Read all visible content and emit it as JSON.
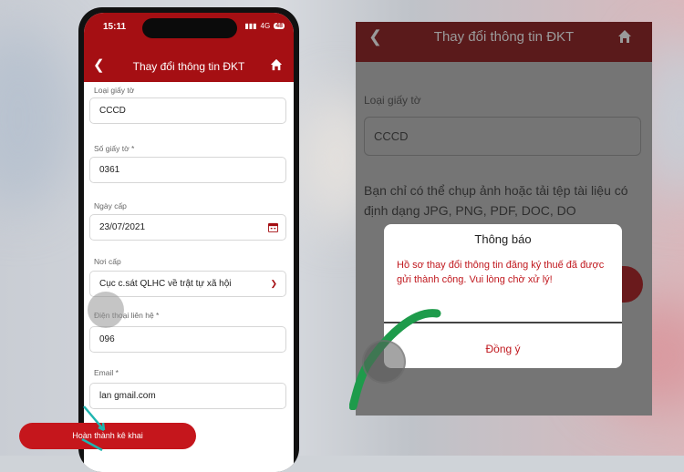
{
  "status": {
    "time": "15:11",
    "network": "4G",
    "battery": "48"
  },
  "header": {
    "title": "Thay đổi thông tin ĐKT"
  },
  "form": {
    "fields": [
      {
        "label": "Loại giấy tờ",
        "value": "CCCD"
      },
      {
        "label": "Số giấy tờ *",
        "value": "0361"
      },
      {
        "label": "Ngày cấp",
        "value": "23/07/2021"
      },
      {
        "label": "Nơi cấp",
        "value": "Cục c.sát QLHC về trật tự xã hội"
      },
      {
        "label": "Điện thoại liên hệ *",
        "value": "096"
      },
      {
        "label": "Email *",
        "value": "lan                    gmail.com"
      }
    ],
    "submit_label": "Hoàn thành kê khai"
  },
  "zoom": {
    "title": "Thay đổi thông tin ĐKT",
    "label": "Loại giấy tờ",
    "value": "CCCD",
    "info": "Bạn chỉ có thể chụp ảnh hoặc tải tệp tài liệu có định dạng JPG, PNG, PDF, DOC, DO"
  },
  "dialog": {
    "title": "Thông báo",
    "message": "Hồ sơ thay đổi thông tin đăng ký thuế đã được gửi thành công. Vui lòng chờ xử lý!",
    "button": "Đồng ý"
  },
  "colors": {
    "brand_red": "#a50f13",
    "button_red": "#c5161c",
    "annotation_green": "#1e9b4b",
    "arrow_teal": "#1fb5b0"
  }
}
